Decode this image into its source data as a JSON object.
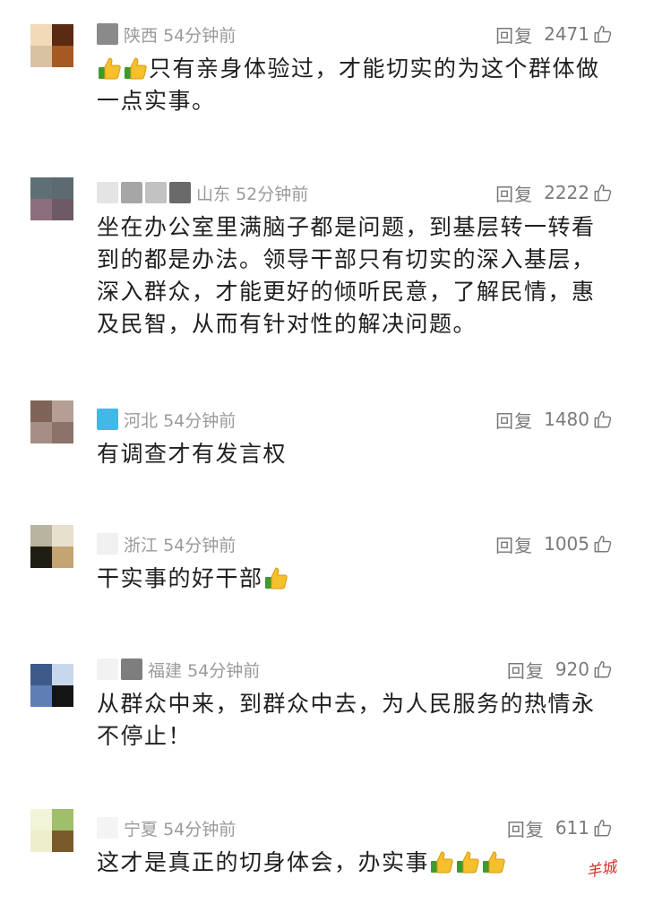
{
  "comments": [
    {
      "location": "陕西",
      "time": "54分钟前",
      "reply": "回复",
      "likes": "2471",
      "text": "只有亲身体验过，才能切实的为这个群体做一点实事。",
      "emoji_before": 2,
      "emoji_after": 0,
      "avatar_colors": [
        "#f2d9b8",
        "#5a2a12",
        "#d9c2a2",
        "#a45a22"
      ],
      "nick_colors": [
        "#8a8a8a"
      ]
    },
    {
      "location": "山东",
      "time": "52分钟前",
      "reply": "回复",
      "likes": "2222",
      "text": "坐在办公室里满脑子都是问题，到基层转一转看到的都是办法。领导干部只有切实的深入基层，深入群众，才能更好的倾听民意，了解民情，惠及民智，从而有针对性的解决问题。",
      "emoji_before": 0,
      "emoji_after": 0,
      "avatar_colors": [
        "#5f6f76",
        "#5d6a70",
        "#8c6e7c",
        "#6d5a66"
      ],
      "nick_colors": [
        "#e4e4e4",
        "#a6a6a6",
        "#c2c2c2",
        "#6a6a6a"
      ]
    },
    {
      "location": "河北",
      "time": "54分钟前",
      "reply": "回复",
      "likes": "1480",
      "text": "有调查才有发言权",
      "emoji_before": 0,
      "emoji_after": 0,
      "avatar_colors": [
        "#7d6358",
        "#b59e94",
        "#a48e86",
        "#8b7369"
      ],
      "nick_colors": [
        "#41b8e6"
      ]
    },
    {
      "location": "浙江",
      "time": "54分钟前",
      "reply": "回复",
      "likes": "1005",
      "text": "干实事的好干部",
      "emoji_before": 0,
      "emoji_after": 1,
      "avatar_colors": [
        "#b8b4a0",
        "#e6e0cc",
        "#1e1e14",
        "#c4a472"
      ],
      "nick_colors": [
        "#f0f0f0"
      ]
    },
    {
      "location": "福建",
      "time": "54分钟前",
      "reply": "回复",
      "likes": "920",
      "text": "从群众中来，到群众中去，为人民服务的热情永不停止！",
      "emoji_before": 0,
      "emoji_after": 0,
      "avatar_colors": [
        "#3d5a8a",
        "#c8d8ec",
        "#5e7eb4",
        "#141414"
      ],
      "nick_colors": [
        "#f2f2f2",
        "#7e7e7e"
      ]
    },
    {
      "location": "宁夏",
      "time": "54分钟前",
      "reply": "回复",
      "likes": "611",
      "text": "这才是真正的切身体会，办实事",
      "emoji_before": 0,
      "emoji_after": 3,
      "avatar_colors": [
        "#f2f4d8",
        "#9fbf6a",
        "#eeeecc",
        "#7a5a2a"
      ],
      "nick_colors": [
        "#f4f4f4"
      ]
    }
  ],
  "watermark": "羊城"
}
